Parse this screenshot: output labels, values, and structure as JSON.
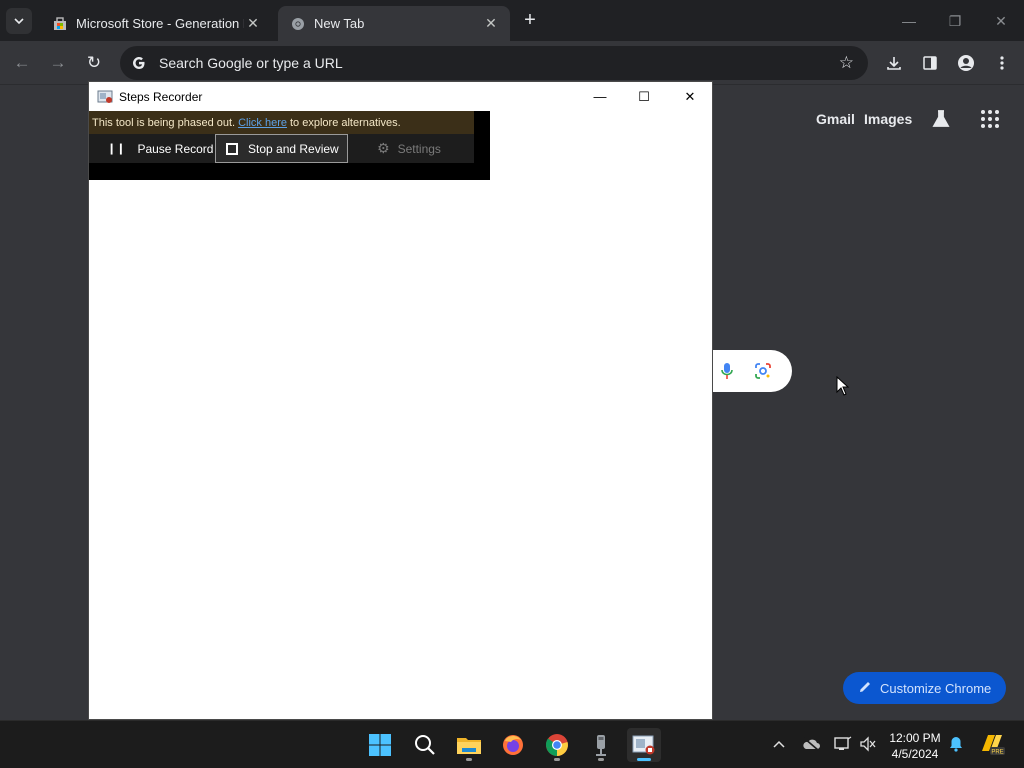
{
  "browser": {
    "tabs": [
      {
        "title": "Microsoft Store - Generation Pr",
        "active": false
      },
      {
        "title": "New Tab",
        "active": true
      }
    ],
    "omnibox": {
      "placeholder": "Search Google or type a URL"
    },
    "ntp": {
      "links": [
        "Gmail",
        "Images"
      ],
      "customize_label": "Customize Chrome"
    }
  },
  "steps_recorder": {
    "title": "Steps Recorder",
    "warning": {
      "prefix": "This tool is being phased out.",
      "link": "Click here",
      "suffix": "to explore alternatives."
    },
    "buttons": {
      "pause": "Pause Record",
      "stop": "Stop and Review",
      "settings": "Settings"
    }
  },
  "taskbar": {
    "apps": [
      "start-icon",
      "search-icon",
      "file-explorer-icon",
      "firefox-icon",
      "chrome-icon",
      "microphone-app-icon",
      "steps-recorder-icon"
    ],
    "clock": {
      "time": "12:00 PM",
      "date": "4/5/2024"
    }
  },
  "colors": {
    "accent_blue": "#0b57d0",
    "chrome_dark": "#35363a",
    "taskbar": "#1c1c1c"
  }
}
